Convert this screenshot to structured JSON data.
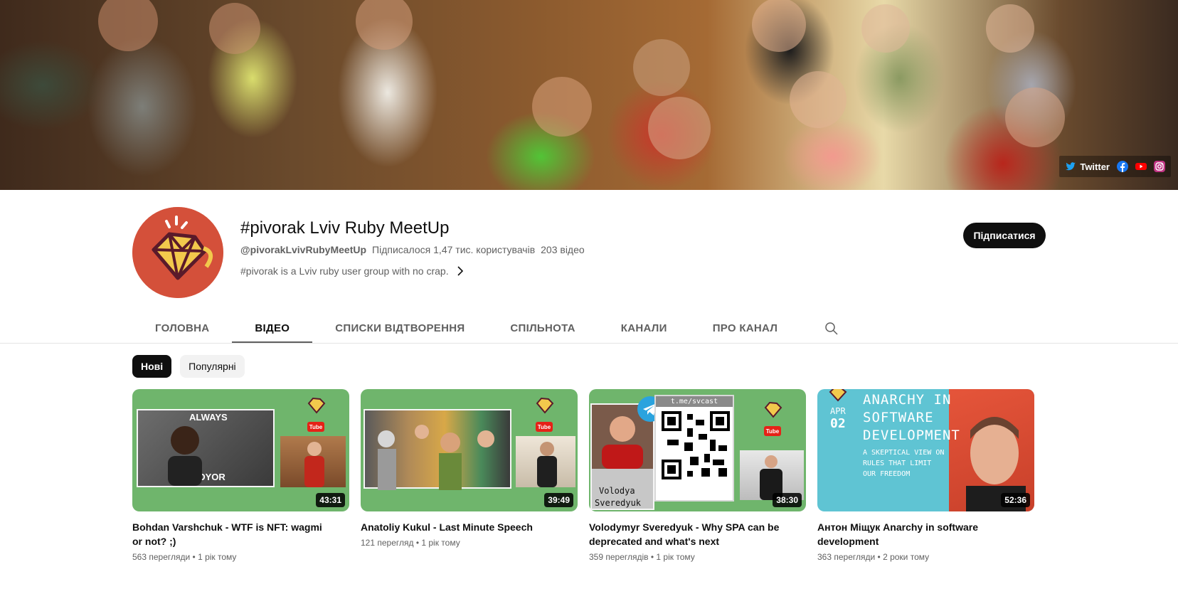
{
  "banner": {
    "links": [
      {
        "label": "Twitter",
        "icon": "twitter-icon",
        "color": "#1da1f2"
      },
      {
        "label": "",
        "icon": "facebook-icon",
        "color": "#1877f2"
      },
      {
        "label": "",
        "icon": "youtube-icon",
        "color": "#ff0000"
      },
      {
        "label": "",
        "icon": "instagram-icon",
        "color": "#c13584"
      }
    ]
  },
  "channel": {
    "title": "#pivorak Lviv Ruby MeetUp",
    "handle": "@pivorakLvivRubyMeetUp",
    "subscribers": "Підписалося 1,47 тис. користувачів",
    "video_count": "203 відео",
    "description": "#pivorak is a Lviv ruby user group with no crap.",
    "subscribe_label": "Підписатися"
  },
  "tabs": [
    {
      "label": "ГОЛОВНА",
      "active": false
    },
    {
      "label": "ВІДЕО",
      "active": true
    },
    {
      "label": "СПИСКИ ВІДТВОРЕННЯ",
      "active": false
    },
    {
      "label": "СПІЛЬНОТА",
      "active": false
    },
    {
      "label": "КАНАЛИ",
      "active": false
    },
    {
      "label": "ПРО КАНАЛ",
      "active": false
    }
  ],
  "chips": [
    {
      "label": "Нові",
      "active": true
    },
    {
      "label": "Популярні",
      "active": false
    }
  ],
  "videos": [
    {
      "title": "Bohdan Varshchuk - WTF is NFT: wagmi or not? ;)",
      "views": "563 перегляди",
      "age": "1 рік тому",
      "duration": "43:31",
      "thumb_text": [
        "ALWAYS",
        "#DYOR"
      ],
      "tube_label": "Tube"
    },
    {
      "title": "Anatoliy Kukul - Last Minute Speech",
      "views": "121 перегляд",
      "age": "1 рік тому",
      "duration": "39:49",
      "thumb_text": [],
      "tube_label": "Tube"
    },
    {
      "title": "Volodymyr Sveredyuk - Why SPA can be deprecated and what's next",
      "views": "359 переглядів",
      "age": "1 рік тому",
      "duration": "38:30",
      "thumb_text": [
        "t.me/svcast",
        "Volodya",
        "Sveredyuk"
      ],
      "tube_label": "Tube"
    },
    {
      "title": "Антон Міщук Anarchy in software development",
      "views": "363 перегляди",
      "age": "2 роки тому",
      "duration": "52:36",
      "thumb_text": [
        "APR",
        "02",
        "ANARCHY IN",
        "SOFTWARE",
        "DEVELOPMENT",
        "A SKEPTICAL VIEW ON",
        "RULES THAT LIMIT",
        "OUR FREEDOM"
      ],
      "tube_label": ""
    }
  ]
}
